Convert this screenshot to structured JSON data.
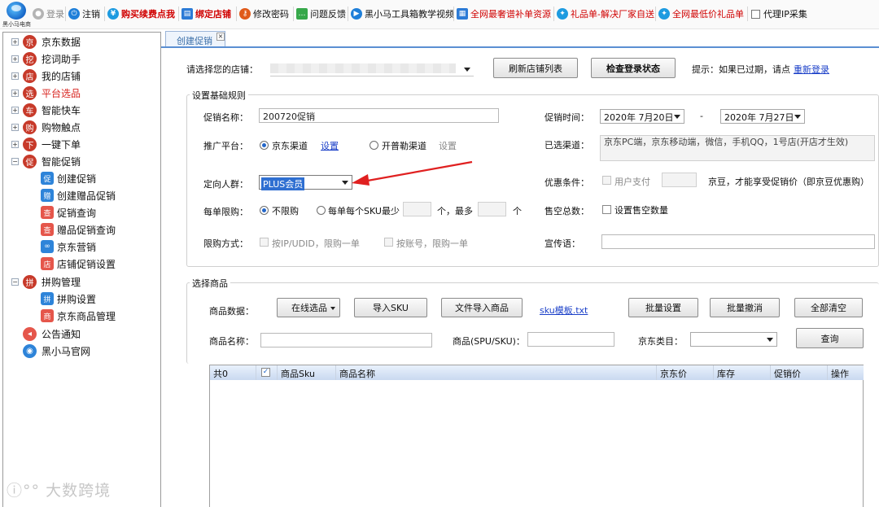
{
  "logo": {
    "text": "黑小马电商"
  },
  "toolbar": {
    "login": "登录",
    "logout": "注销",
    "buy": "购买续费点我",
    "bind_shop": "绑定店铺",
    "change_password": "修改密码",
    "feedback": "问题反馈",
    "tutorial": "黑小马工具箱教学视频",
    "resource": "全网最奢谱补单资源",
    "gift_factory": "礼品单-解决厂家自送",
    "lowest_gift": "全网最低价礼品单",
    "proxy_ip": "代理IP采集"
  },
  "sidebar": {
    "items": [
      {
        "label": "京东数据",
        "icon": "京"
      },
      {
        "label": "挖词助手",
        "icon": "挖"
      },
      {
        "label": "我的店铺",
        "icon": "店"
      },
      {
        "label": "平台选品",
        "icon": "选"
      },
      {
        "label": "智能快车",
        "icon": "车"
      },
      {
        "label": "购物触点",
        "icon": "购"
      },
      {
        "label": "一键下单",
        "icon": "下"
      },
      {
        "label": "智能促销",
        "icon": "促"
      }
    ],
    "promo_children": [
      "创建促销",
      "创建赠品促销",
      "促销查询",
      "赠品促销查询",
      "京东营销",
      "店铺促销设置"
    ],
    "group": {
      "label": "拼购管理",
      "icon": "拼"
    },
    "group_children": [
      "拼购设置",
      "京东商品管理"
    ],
    "notice": "公告通知",
    "website": "黑小马官网"
  },
  "tab": {
    "label": "创建促销",
    "close": "×"
  },
  "shop": {
    "label": "请选择您的店铺：",
    "refresh_button": "刷新店铺列表",
    "check_button": "检查登录状态",
    "hint": "提示：如果已过期，请点",
    "relogin": "重新登录"
  },
  "rules": {
    "legend": "设置基础规则",
    "promo_name_label": "促销名称：",
    "promo_name_value": "200720促销",
    "promo_time_label": "促销时间：",
    "start_date": "2020年 7月20日",
    "dash": "-",
    "end_date": "2020年 7月27日",
    "platform_label": "推广平台：",
    "jd_channel": "京东渠道",
    "jd_setting": "设置",
    "kaipule_channel": "开普勒渠道",
    "kaipule_setting": "设置",
    "selected_channel_label": "已选渠道：",
    "selected_channel_value": "京东PC端，京东移动端，微信，手机QQ，1号店(开店才生效)",
    "audience_label": "定向人群：",
    "audience_value": "PLUS会员",
    "discount_label": "优惠条件：",
    "user_pay": "用户支付",
    "discount_suffix": "京豆，才能享受促销价（即京豆优惠购）",
    "limit_label": "每单限购：",
    "no_limit": "不限购",
    "per_sku_min": "每单每个SKU最少",
    "unit1": "个，最多",
    "unit2": "个",
    "sold_out_label": "售空总数：",
    "set_sold_out": "设置售空数量",
    "limit_mode_label": "限购方式：",
    "by_ip": "按IP/UDID，限购一单",
    "by_account": "按账号，限购一单",
    "slogan_label": "宣传语："
  },
  "products": {
    "legend": "选择商品",
    "data_label": "商品数据：",
    "online_select": "在线选品",
    "import_sku": "导入SKU",
    "file_import": "文件导入商品",
    "sku_template": "sku模板.txt",
    "batch_set": "批量设置",
    "batch_cancel": "批量撤消",
    "clear_all": "全部清空",
    "name_label": "商品名称：",
    "sku_label": "商品(SPU/SKU)：",
    "category_label": "京东类目：",
    "query": "查询"
  },
  "grid": {
    "columns": [
      "共0",
      "",
      "商品Sku",
      "商品名称",
      "京东价",
      "库存",
      "促销价",
      "操作"
    ]
  },
  "watermark": "大数跨境",
  "colors": {
    "accent": "#2467c9",
    "brand_red": "#d8241f",
    "header_blue": "#c9d9f0",
    "arrow": "#e02020"
  }
}
